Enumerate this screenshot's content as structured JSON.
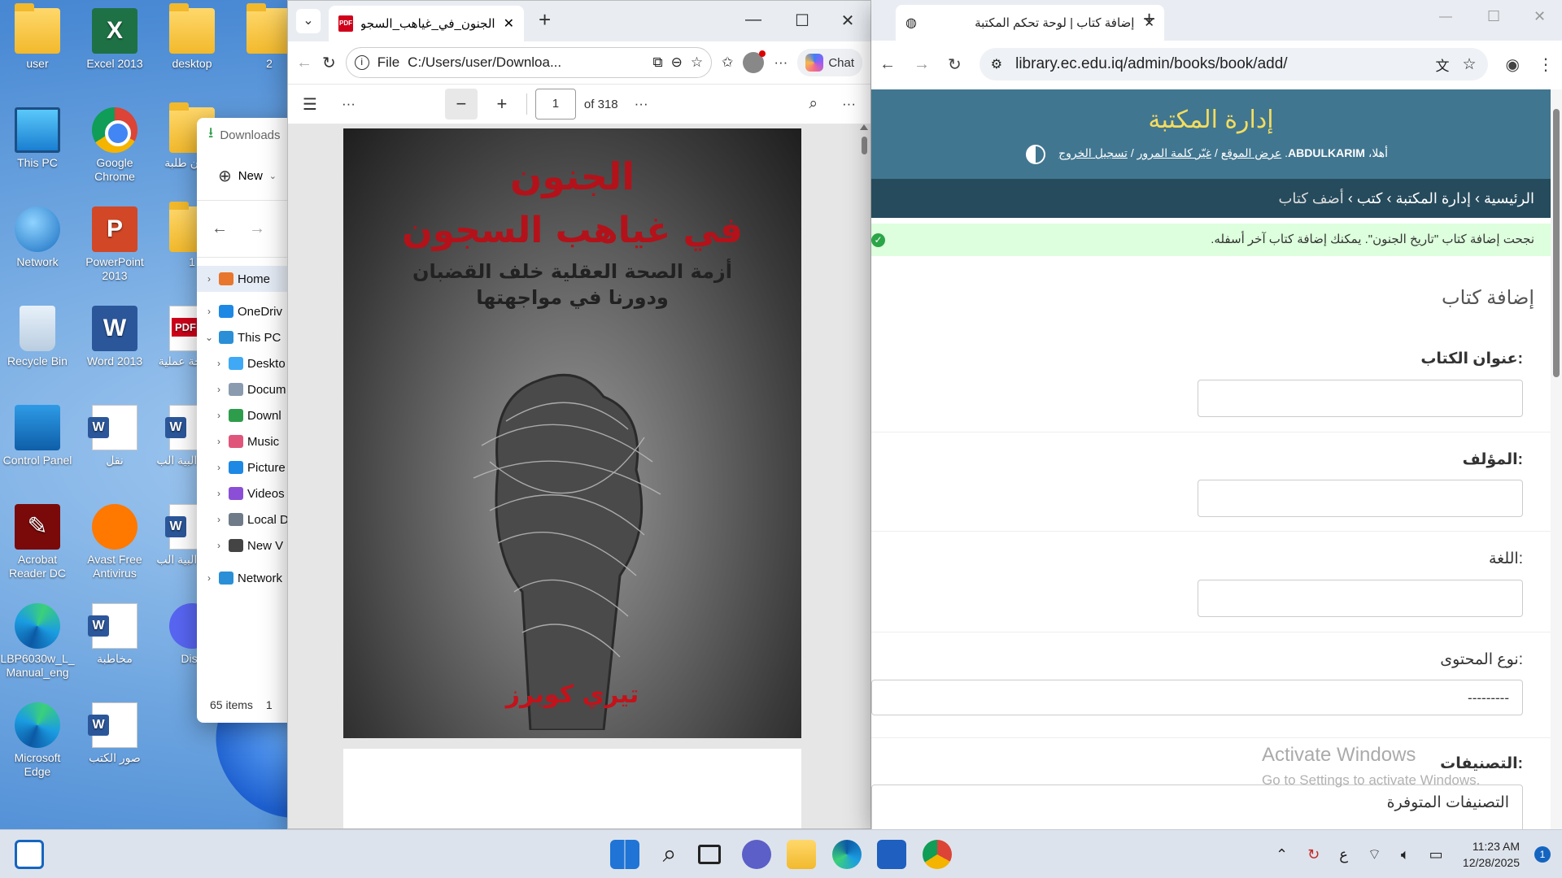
{
  "desktop": {
    "icons": [
      {
        "label": "user",
        "icon": "user-folder-icon"
      },
      {
        "label": "Excel 2013",
        "icon": "excel-icon"
      },
      {
        "label": "desktop",
        "icon": "folder-icon"
      },
      {
        "label": "2",
        "icon": "folder-icon"
      },
      {
        "label": "This PC",
        "icon": "computer-icon"
      },
      {
        "label": "Google Chrome",
        "icon": "chrome-icon"
      },
      {
        "label": "شؤون طلبة",
        "icon": "folder-icon"
      },
      {
        "label": "Network",
        "icon": "network-icon"
      },
      {
        "label": "PowerPoint 2013",
        "icon": "powerpoint-icon"
      },
      {
        "label": "1",
        "icon": "folder-icon"
      },
      {
        "label": "Recycle Bin",
        "icon": "recycle-bin-icon"
      },
      {
        "label": "Word 2013",
        "icon": "word-icon"
      },
      {
        "label": "اطروحة عملية",
        "icon": "pdf-file-icon"
      },
      {
        "label": "Control Panel",
        "icon": "control-panel-icon"
      },
      {
        "label": "نقل",
        "icon": "word-doc-icon"
      },
      {
        "label": "مراكز البية الب",
        "icon": "word-doc-icon"
      },
      {
        "label": "Acrobat Reader DC",
        "icon": "acrobat-icon"
      },
      {
        "label": "Avast Free Antivirus",
        "icon": "avast-icon"
      },
      {
        "label": "مراكز البية الب",
        "icon": "word-doc-icon"
      },
      {
        "label": "LBP6030w_L_ Manual_eng",
        "icon": "edge-pdf-icon"
      },
      {
        "label": "مخاطبة",
        "icon": "word-doc-icon"
      },
      {
        "label": "Disc",
        "icon": "discord-icon"
      },
      {
        "label": "Microsoft Edge",
        "icon": "edge-icon"
      },
      {
        "label": "صور الكتب",
        "icon": "word-doc-icon"
      }
    ]
  },
  "explorer": {
    "title": "Downloads",
    "new_label": "New",
    "tree": [
      {
        "label": "Home",
        "color": "#e8762c"
      },
      {
        "label": "OneDriv",
        "color": "#1e88e5"
      },
      {
        "label": "This PC",
        "color": "#2a8fd6"
      },
      {
        "label": "Deskto",
        "color": "#3fa9f5"
      },
      {
        "label": "Docum",
        "color": "#8a9bb0"
      },
      {
        "label": "Downl",
        "color": "#2e9d4b"
      },
      {
        "label": "Music",
        "color": "#e0567a"
      },
      {
        "label": "Picture",
        "color": "#1e88e5"
      },
      {
        "label": "Videos",
        "color": "#8a4fd6"
      },
      {
        "label": "Local D",
        "color": "#6f7b88"
      },
      {
        "label": "New V",
        "color": "#444"
      },
      {
        "label": "Network",
        "color": "#2a8fd6"
      }
    ],
    "status": "65 items",
    "status2": "1"
  },
  "pdf_window": {
    "tab_title": "الجنون_في_غياهب_السجون.pdf",
    "address_prefix": "File",
    "address": "C:/Users/user/Downloa...",
    "chat_label": "Chat",
    "page_current": "1",
    "page_total": "of 318",
    "cover": {
      "title_line1": "الجنون",
      "title_line2": "في غياهب السجون",
      "subtitle_line1": "أزمة الصحة العقلية خلف القضبان",
      "subtitle_line2": "ودورنا في مواجهتها",
      "author": "تيري كوبرز"
    }
  },
  "chrome": {
    "tab_title": "إضافة كتاب | لوحة تحكم المكتبة",
    "url": "library.ec.edu.iq/admin/books/book/add/",
    "site_title": "إدارة المكتبة",
    "welcome_prefix": "أهلا،",
    "username": "ABDULKARIM",
    "links": [
      "عرض الموقع",
      "غيّر كلمة المرور",
      "تسجيل الخروج"
    ],
    "breadcrumbs": [
      "الرئيسية",
      "إدارة المكتبة",
      "كتب",
      "أضف كتاب"
    ],
    "success_message": "نجحت إضافة كتاب \"تاريخ الجنون\". يمكنك إضافة كتاب آخر أسفله.",
    "form_title": "إضافة كتاب",
    "fields": {
      "title": "عنوان الكتاب:",
      "author": "المؤلف:",
      "language": "اللغة:",
      "content_type": "نوع المحتوى:",
      "content_type_value": "---------",
      "categories": "التصنيفات:",
      "categories_available": "التصنيفات المتوفرة"
    },
    "watermark_title": "Activate Windows",
    "watermark_sub": "Go to Settings to activate Windows."
  },
  "taskbar": {
    "lang": "ع",
    "time": "11:23 AM",
    "date": "12/28/2025",
    "notifications": "1"
  }
}
